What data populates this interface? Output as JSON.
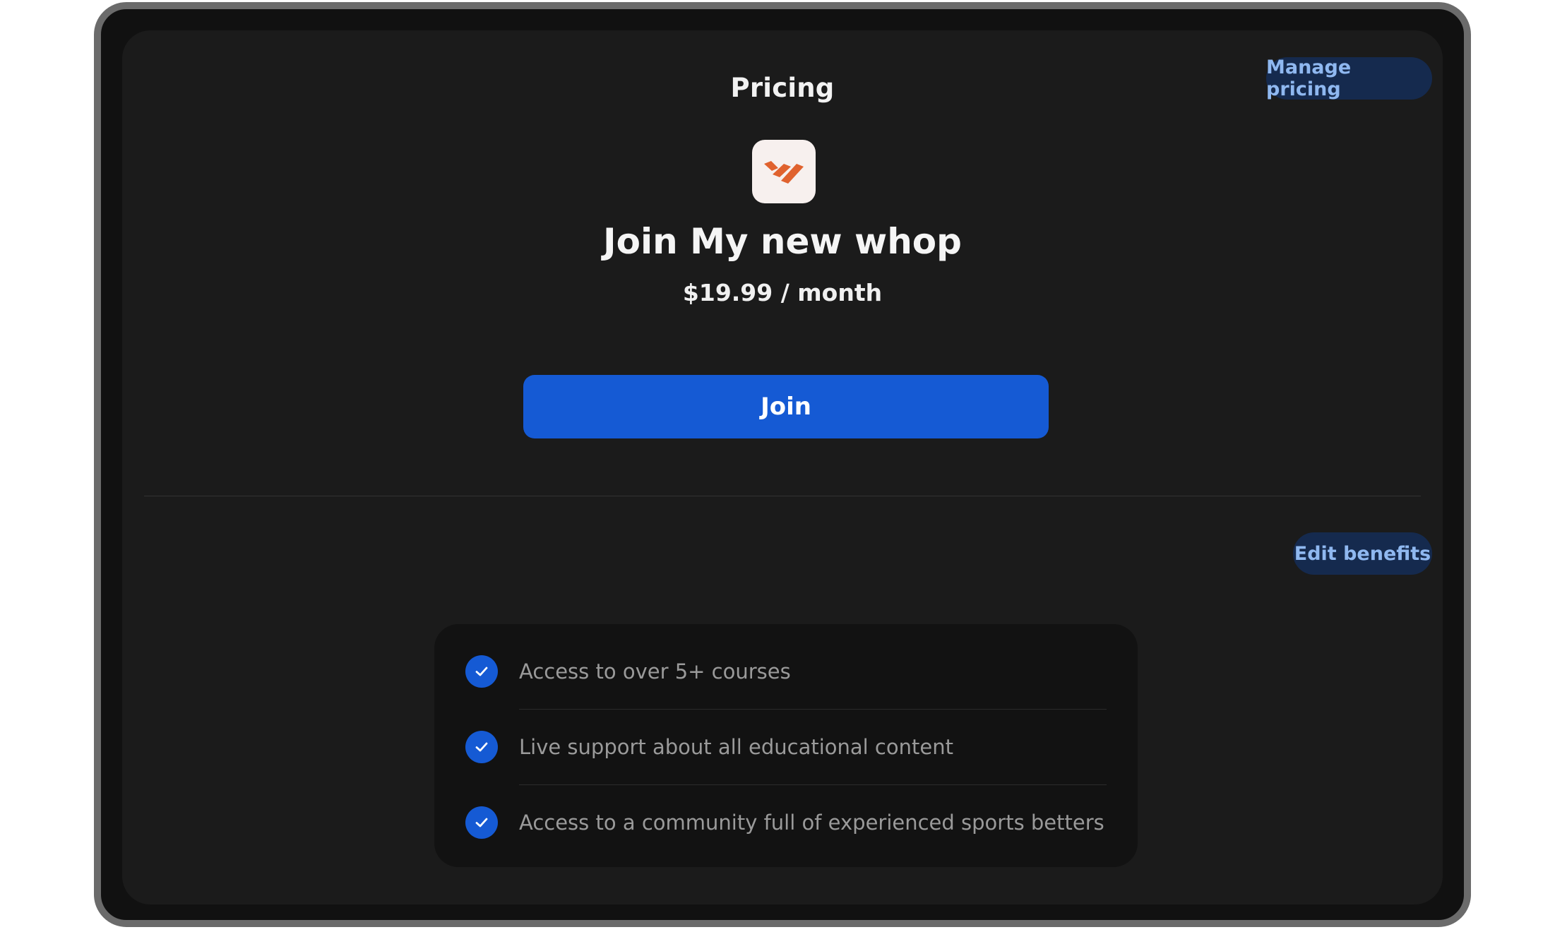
{
  "header": {
    "title": "Pricing",
    "manage_label": "Manage pricing"
  },
  "product": {
    "logo_icon": "whop-logo-icon",
    "brand_color": "#e0622e",
    "title": "Join My new whop",
    "price": "$19.99 / month",
    "join_label": "Join"
  },
  "benefits": {
    "edit_label": "Edit benefits",
    "items": [
      {
        "label": "Access to over 5+ courses"
      },
      {
        "label": "Live support about all educational content"
      },
      {
        "label": "Access to a community full of experienced sports betters"
      }
    ]
  },
  "colors": {
    "accent": "#155ad4",
    "background": "#1b1b1b",
    "card": "#121212"
  }
}
